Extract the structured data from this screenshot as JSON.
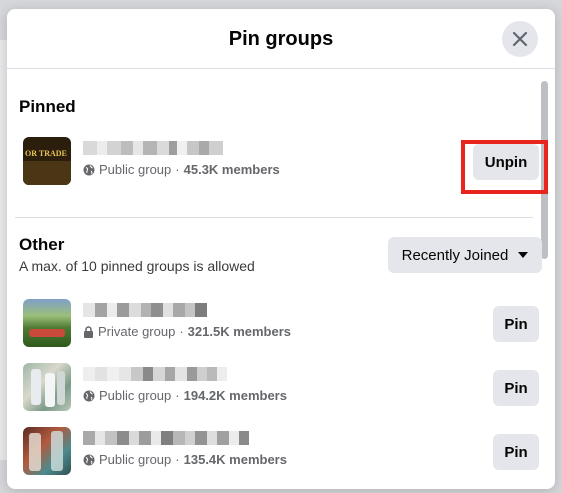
{
  "modal": {
    "title": "Pin groups"
  },
  "pinned": {
    "title": "Pinned",
    "groups": [
      {
        "thumb_text": "OR TRADE",
        "privacy": "Public group",
        "members": "45.3K members",
        "button_label": "Unpin"
      }
    ]
  },
  "other": {
    "title": "Other",
    "subtitle": "A max. of 10 pinned groups is allowed",
    "sort_label": "Recently Joined",
    "groups": [
      {
        "privacy": "Private group",
        "members": "321.5K members",
        "button_label": "Pin"
      },
      {
        "privacy": "Public group",
        "members": "194.2K members",
        "button_label": "Pin"
      },
      {
        "privacy": "Public group",
        "members": "135.4K members",
        "button_label": "Pin"
      }
    ]
  },
  "meta_separator": "·",
  "colors": {
    "button_bg": "#e4e6eb",
    "highlight": "#e8241f",
    "secondary_text": "#65676b"
  }
}
